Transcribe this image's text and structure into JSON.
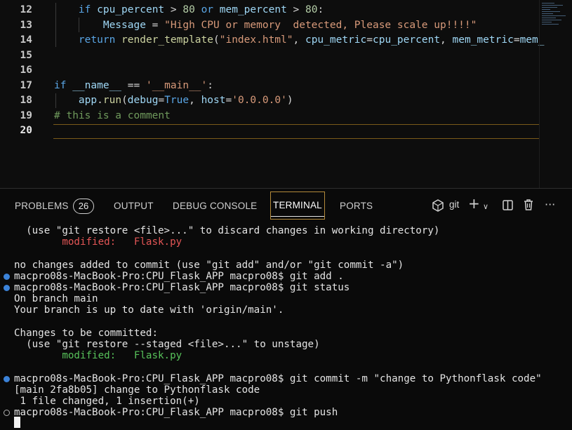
{
  "editor": {
    "lines": [
      {
        "num": "12",
        "tokens": [
          {
            "t": "    "
          },
          {
            "t": "if",
            "c": "kw"
          },
          {
            "t": " "
          },
          {
            "t": "cpu_percent",
            "c": "var"
          },
          {
            "t": " > "
          },
          {
            "t": "80",
            "c": "num"
          },
          {
            "t": " "
          },
          {
            "t": "or",
            "c": "kw"
          },
          {
            "t": " "
          },
          {
            "t": "mem_percent",
            "c": "var"
          },
          {
            "t": " > "
          },
          {
            "t": "80",
            "c": "num"
          },
          {
            "t": ":"
          }
        ]
      },
      {
        "num": "13",
        "tokens": [
          {
            "t": "        "
          },
          {
            "t": "Message",
            "c": "var"
          },
          {
            "t": " = "
          },
          {
            "t": "\"High CPU or memory  detected, Please scale up!!!!\"",
            "c": "str"
          }
        ]
      },
      {
        "num": "14",
        "tokens": [
          {
            "t": "    "
          },
          {
            "t": "return",
            "c": "kw"
          },
          {
            "t": " "
          },
          {
            "t": "render_template",
            "c": "fn"
          },
          {
            "t": "("
          },
          {
            "t": "\"index.html\"",
            "c": "str"
          },
          {
            "t": ", "
          },
          {
            "t": "cpu_metric",
            "c": "var"
          },
          {
            "t": "="
          },
          {
            "t": "cpu_percent",
            "c": "var"
          },
          {
            "t": ", "
          },
          {
            "t": "mem_metric",
            "c": "var"
          },
          {
            "t": "="
          },
          {
            "t": "mem_",
            "c": "var"
          }
        ]
      },
      {
        "num": "15",
        "tokens": []
      },
      {
        "num": "16",
        "tokens": []
      },
      {
        "num": "17",
        "tokens": [
          {
            "t": "if",
            "c": "kw"
          },
          {
            "t": " "
          },
          {
            "t": "__name__",
            "c": "var"
          },
          {
            "t": " == "
          },
          {
            "t": "'__main__'",
            "c": "str"
          },
          {
            "t": ":"
          }
        ]
      },
      {
        "num": "18",
        "tokens": [
          {
            "t": "    "
          },
          {
            "t": "app",
            "c": "var"
          },
          {
            "t": "."
          },
          {
            "t": "run",
            "c": "fn"
          },
          {
            "t": "("
          },
          {
            "t": "debug",
            "c": "var"
          },
          {
            "t": "="
          },
          {
            "t": "True",
            "c": "bool"
          },
          {
            "t": ", "
          },
          {
            "t": "host",
            "c": "var"
          },
          {
            "t": "="
          },
          {
            "t": "'0.0.0.0'",
            "c": "str"
          },
          {
            "t": ")"
          }
        ]
      },
      {
        "num": "19",
        "tokens": [
          {
            "t": "# this is a comment",
            "c": "cmt"
          }
        ]
      },
      {
        "num": "20",
        "tokens": []
      }
    ]
  },
  "panel": {
    "tabs": {
      "problems": "PROBLEMS",
      "problems_count": "26",
      "output": "OUTPUT",
      "debug_console": "DEBUG CONSOLE",
      "terminal": "TERMINAL",
      "ports": "PORTS"
    },
    "terminal_name": "git",
    "icons": {
      "terminal_icon": "terminal-shell-icon",
      "add": "plus-icon",
      "dropdown": "chevron-down-icon",
      "split": "split-icon",
      "kill": "trash-icon",
      "more": "ellipsis-icon"
    }
  },
  "terminal": {
    "lines": [
      {
        "text": "  (use \"git restore <file>...\" to discard changes in working directory)",
        "style": "plain",
        "dot": ""
      },
      {
        "text": "        modified:   Flask.py",
        "style": "mod",
        "dot": ""
      },
      {
        "text": "",
        "style": "plain",
        "dot": ""
      },
      {
        "text": "no changes added to commit (use \"git add\" and/or \"git commit -a\")",
        "style": "plain",
        "dot": ""
      },
      {
        "text": "macpro08s-MacBook-Pro:CPU_Flask_APP macpro08$ git add .",
        "style": "plain",
        "dot": "blue"
      },
      {
        "text": "macpro08s-MacBook-Pro:CPU_Flask_APP macpro08$ git status",
        "style": "plain",
        "dot": "blue"
      },
      {
        "text": "On branch main",
        "style": "plain",
        "dot": ""
      },
      {
        "text": "Your branch is up to date with 'origin/main'.",
        "style": "plain",
        "dot": ""
      },
      {
        "text": "",
        "style": "plain",
        "dot": ""
      },
      {
        "text": "Changes to be committed:",
        "style": "plain",
        "dot": ""
      },
      {
        "text": "  (use \"git restore --staged <file>...\" to unstage)",
        "style": "plain",
        "dot": ""
      },
      {
        "text": "        modified:   Flask.py",
        "style": "stg",
        "dot": ""
      },
      {
        "text": "",
        "style": "plain",
        "dot": ""
      },
      {
        "text": "macpro08s-MacBook-Pro:CPU_Flask_APP macpro08$ git commit -m \"change to Pythonflask code\"",
        "style": "plain",
        "dot": "blue"
      },
      {
        "text": "[main 2fa8b05] change to Pythonflask code",
        "style": "plain",
        "dot": ""
      },
      {
        "text": " 1 file changed, 1 insertion(+)",
        "style": "plain",
        "dot": ""
      },
      {
        "text": "macpro08s-MacBook-Pro:CPU_Flask_APP macpro08$ git push",
        "style": "plain",
        "dot": "hollow"
      }
    ]
  }
}
